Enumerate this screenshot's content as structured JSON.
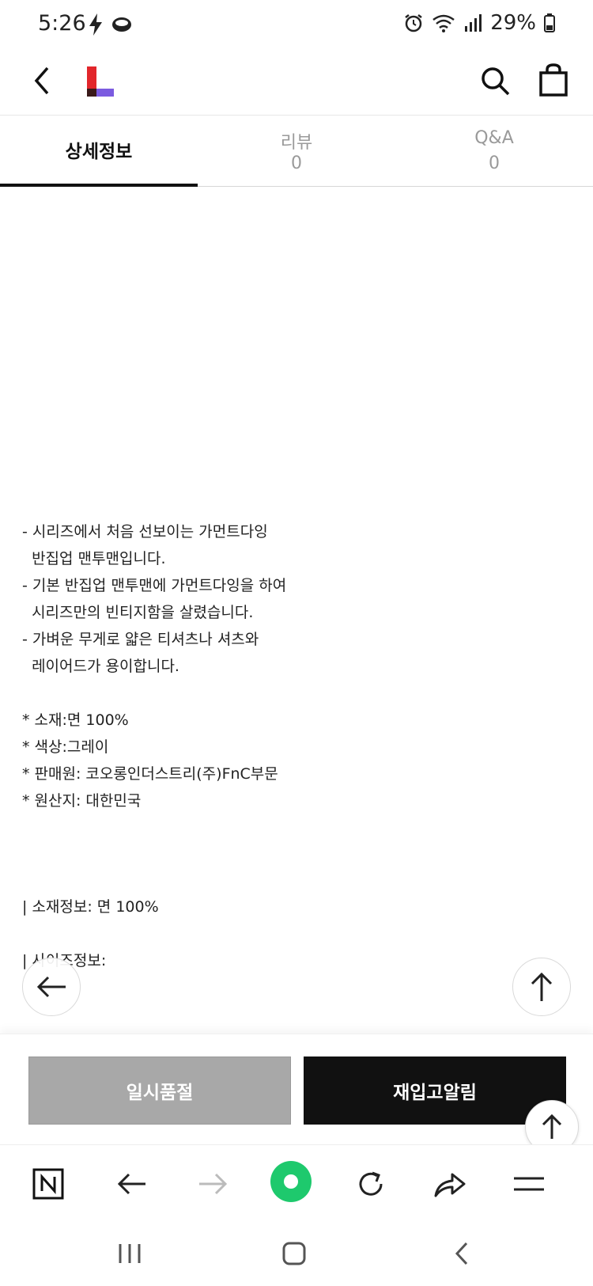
{
  "status_bar": {
    "time": "5:26",
    "battery": "29%"
  },
  "header": {
    "logo_colors": {
      "red": "#e2262b",
      "dark": "#3a1a1a",
      "purple": "#7b5be0"
    }
  },
  "tabs": [
    {
      "label": "상세정보"
    },
    {
      "label": "리뷰",
      "count": "0"
    },
    {
      "label": "Q&A",
      "count": "0"
    }
  ],
  "content": {
    "lines_a": [
      "- 시리즈에서 처음 선보이는 가먼트다잉",
      "  반집업 맨투맨입니다.",
      "- 기본 반집업 맨투맨에 가먼트다잉을 하여",
      "  시리즈만의 빈티지함을 살렸습니다.",
      "- 가벼운 무게로 얇은 티셔츠나 셔츠와",
      "  레이어드가 용이합니다."
    ],
    "lines_b": [
      "* 소재:면 100%",
      "* 색상:그레이",
      "* 판매원: 코오롱인더스트리(주)FnC부문",
      "* 원산지: 대한민국"
    ],
    "material_info": "| 소재정보: 면 100%",
    "size_info": "| 사이즈정보:"
  },
  "actions": {
    "soldout_label": "일시품절",
    "restock_label": "재입고알림"
  },
  "icons": {
    "back": "chevron-left-icon",
    "search": "search-icon",
    "bag": "shopping-bag-icon",
    "float_back": "arrow-left-icon",
    "float_top": "arrow-up-icon"
  },
  "colors": {
    "accent_green": "#1ec96d",
    "soldout_gray": "#a8a8a8",
    "restock_black": "#111111"
  }
}
